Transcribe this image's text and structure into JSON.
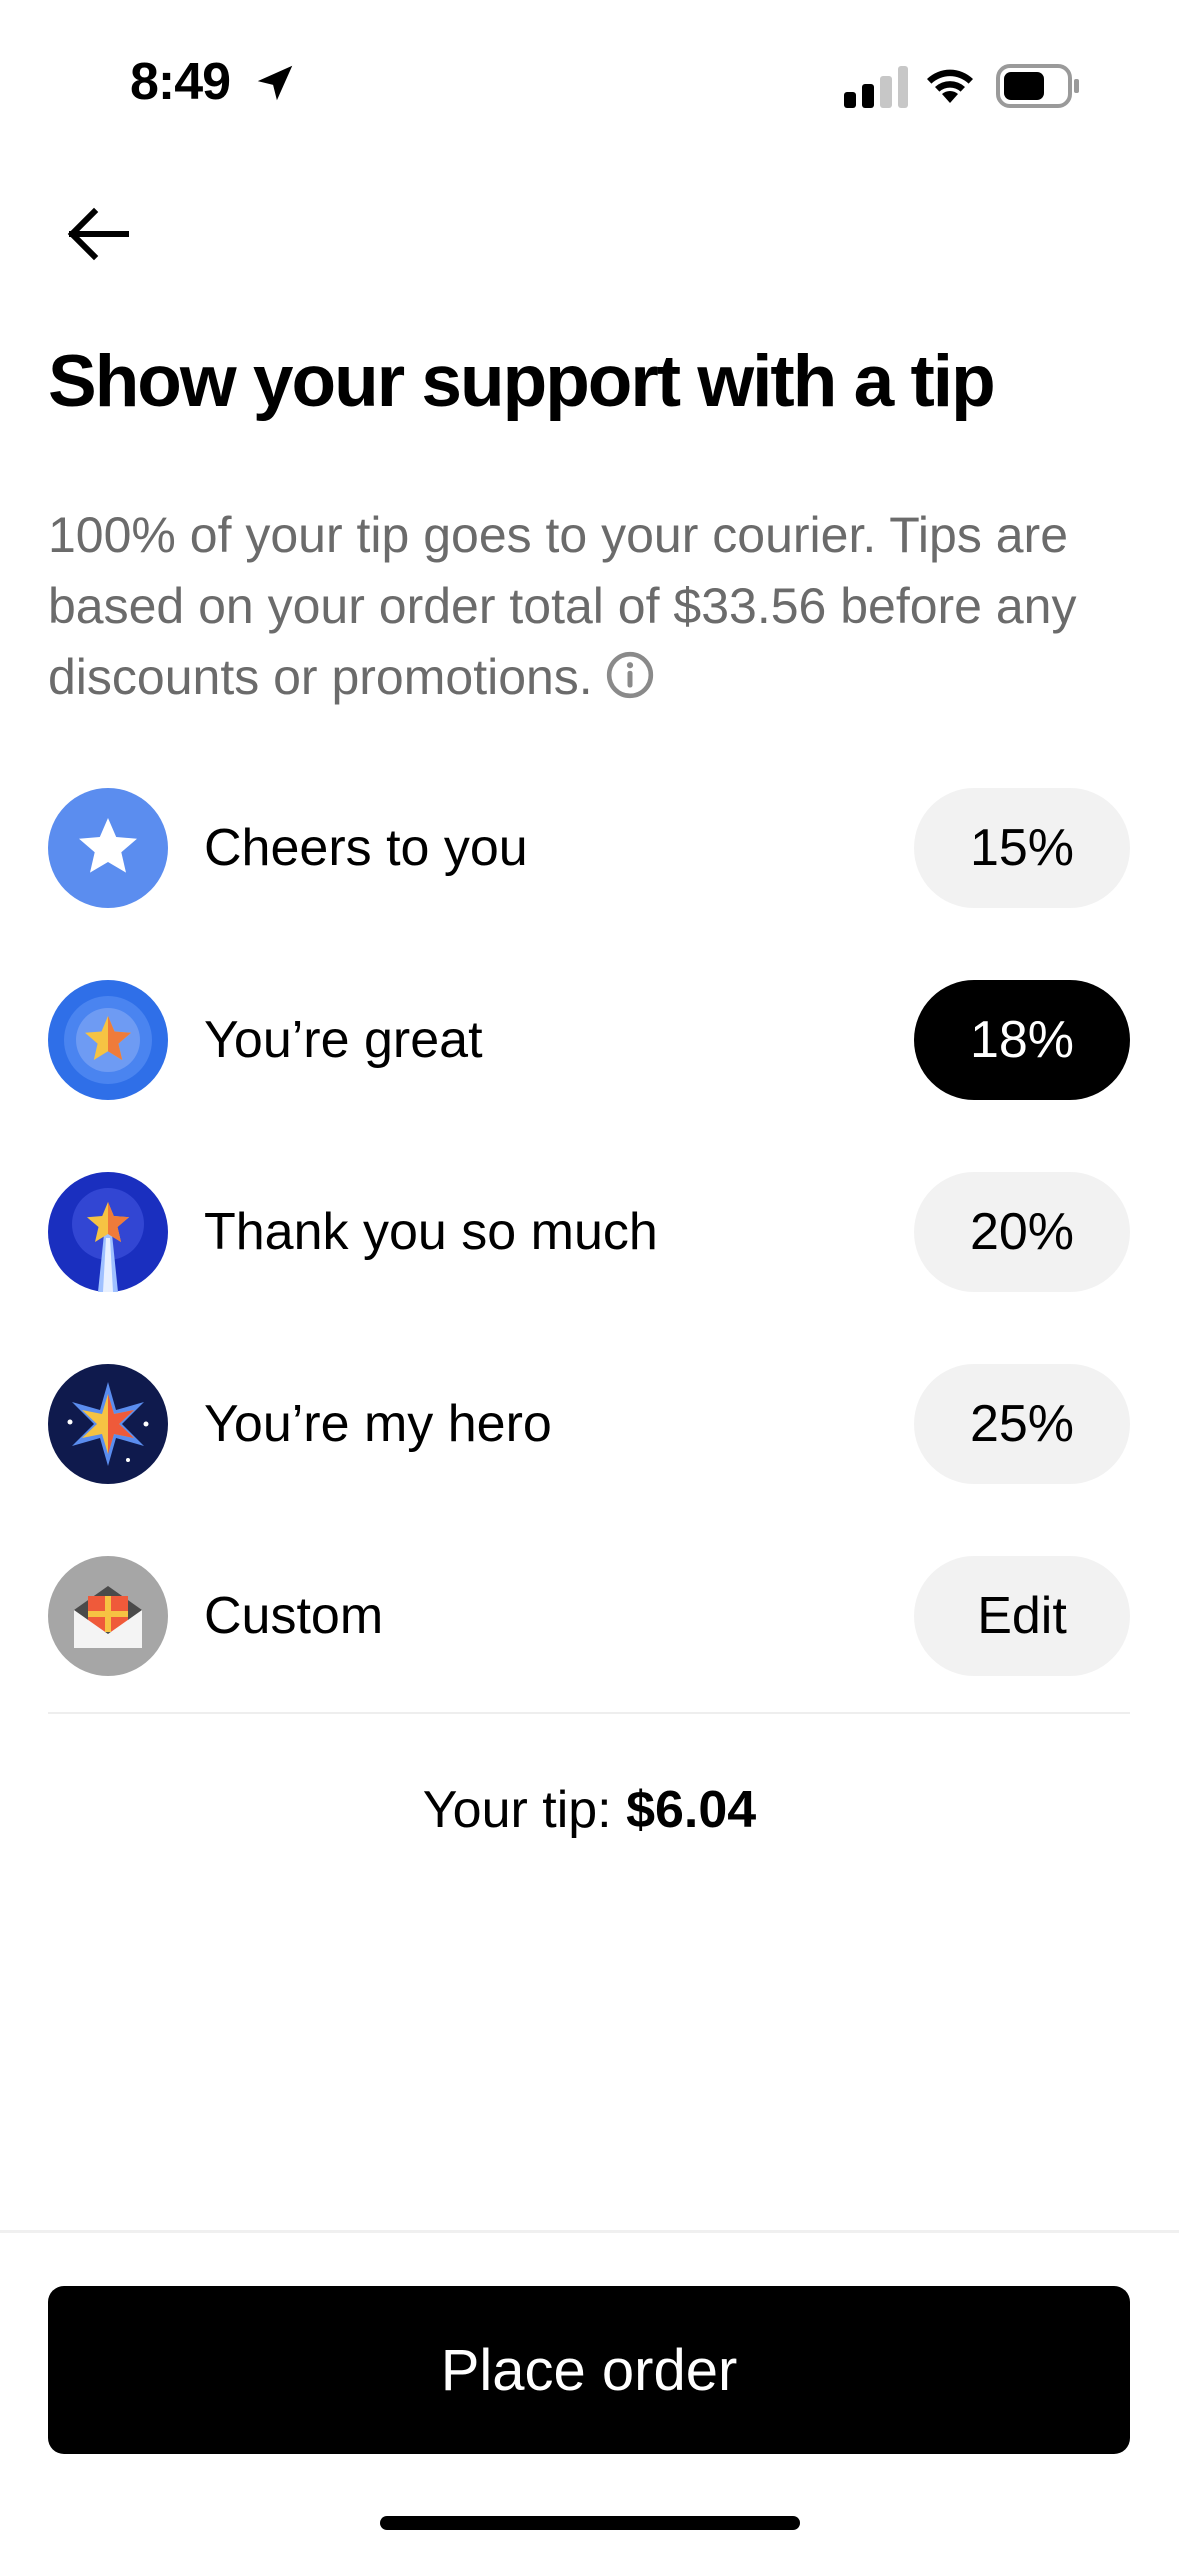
{
  "status_bar": {
    "time": "8:49"
  },
  "header": {
    "back_label": "Back"
  },
  "page": {
    "title": "Show your support with a tip",
    "description": "100% of your tip goes to your courier. Tips are based on your order total of $33.56 before any discounts or promotions."
  },
  "tip_options": [
    {
      "label": "Cheers to you",
      "value": "15%",
      "selected": false,
      "icon": "star-badge-icon"
    },
    {
      "label": "You’re great",
      "value": "18%",
      "selected": true,
      "icon": "star-ring-badge-icon"
    },
    {
      "label": "Thank you so much",
      "value": "20%",
      "selected": false,
      "icon": "shooting-star-badge-icon"
    },
    {
      "label": "You’re my hero",
      "value": "25%",
      "selected": false,
      "icon": "burst-star-badge-icon"
    },
    {
      "label": "Custom",
      "value": "Edit",
      "selected": false,
      "icon": "gift-envelope-icon"
    }
  ],
  "summary": {
    "tip_label": "Your tip:",
    "tip_amount": "$6.04"
  },
  "footer": {
    "place_order_label": "Place order"
  },
  "colors": {
    "selected_pill": "#000000",
    "pill": "#f2f2f2",
    "muted_text": "#6b6b6b"
  }
}
